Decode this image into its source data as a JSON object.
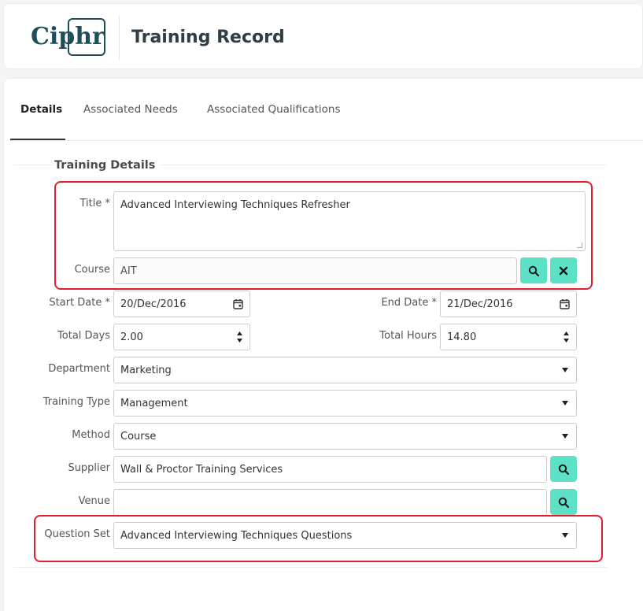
{
  "header": {
    "logo": "Ciphr",
    "title": "Training Record"
  },
  "tabs": [
    {
      "label": "Details",
      "active": true
    },
    {
      "label": "Associated Needs",
      "active": false
    },
    {
      "label": "Associated Qualifications",
      "active": false
    }
  ],
  "section": {
    "title": "Training Details"
  },
  "form": {
    "title": {
      "label": "Title *",
      "value": "Advanced Interviewing Techniques Refresher"
    },
    "course": {
      "label": "Course",
      "value": "AIT"
    },
    "start_date": {
      "label": "Start Date *",
      "value": "20/Dec/2016"
    },
    "end_date": {
      "label": "End Date *",
      "value": "21/Dec/2016"
    },
    "total_days": {
      "label": "Total Days",
      "value": "2.00"
    },
    "total_hours": {
      "label": "Total Hours",
      "value": "14.80"
    },
    "department": {
      "label": "Department",
      "value": "Marketing"
    },
    "training_type": {
      "label": "Training Type",
      "value": "Management"
    },
    "method": {
      "label": "Method",
      "value": "Course"
    },
    "supplier": {
      "label": "Supplier",
      "value": "Wall & Proctor Training Services"
    },
    "venue": {
      "label": "Venue",
      "value": ""
    },
    "question_set": {
      "label": "Question Set",
      "value": "Advanced Interviewing Techniques Questions"
    }
  },
  "colors": {
    "accent_button": "#5ce1c6",
    "highlight": "#e01e2e",
    "brand": "#1f4d59"
  }
}
